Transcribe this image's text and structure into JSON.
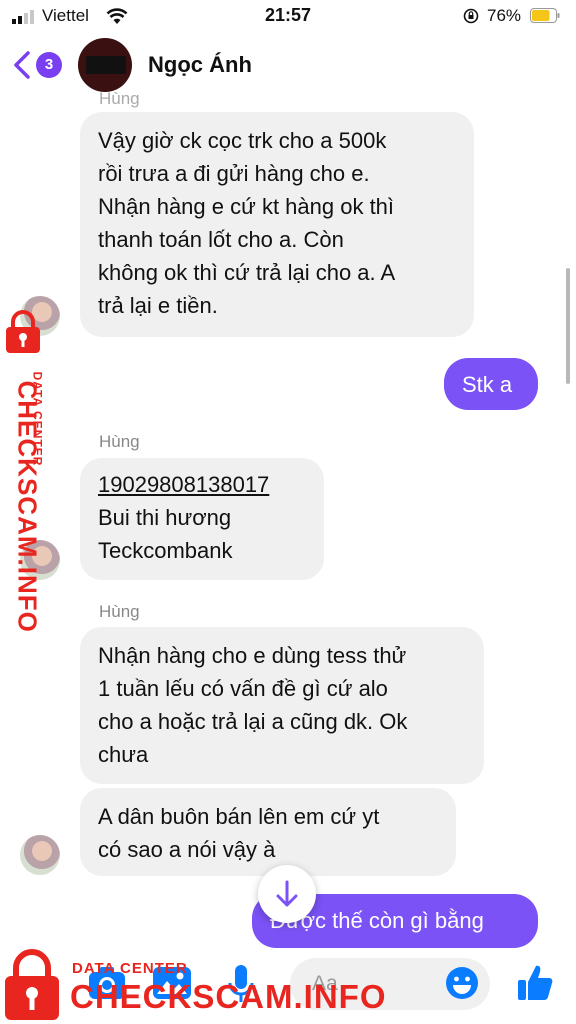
{
  "status_bar": {
    "carrier": "Viettel",
    "time": "21:57",
    "battery": "76%",
    "battery_level": 0.76
  },
  "header": {
    "back_badge": "3",
    "contact_name": "Ngọc Ánh"
  },
  "messages": [
    {
      "sender": "Hùng",
      "direction": "in",
      "lines": [
        "Vậy giờ ck cọc trk cho a 500k",
        "rồi trưa a đi gửi hàng cho e.",
        "Nhận hàng e cứ kt hàng ok thì",
        "thanh toán lốt cho a. Còn",
        "không ok thì cứ trả lại cho a. A",
        "trả lại e tiền."
      ]
    },
    {
      "direction": "out",
      "lines": [
        "Stk a"
      ]
    },
    {
      "sender": "Hùng",
      "direction": "in",
      "lines": [
        "19029808138017",
        "Bui thi hương",
        "Teckcombank"
      ]
    },
    {
      "sender": "Hùng",
      "direction": "in",
      "lines": [
        "Nhận hàng cho e dùng tess thử",
        "1 tuần lếu có vấn đề gì cứ alo",
        "cho a hoặc trả lại a cũng dk. Ok",
        "chưa"
      ]
    },
    {
      "direction": "in",
      "lines": [
        "A dân buôn bán lên em cứ yt",
        "có sao a nói vậy à"
      ]
    },
    {
      "direction": "out",
      "lines": [
        "Được thế còn gì bằng"
      ]
    }
  ],
  "composer": {
    "placeholder": "Aa"
  },
  "watermark": {
    "small": "DATA CENTER",
    "big": "CHECKSCAM.INFO"
  },
  "colors": {
    "accent": "#7a52f5",
    "incoming_bubble": "#f0f0f0",
    "watermark": "#e8261f"
  }
}
